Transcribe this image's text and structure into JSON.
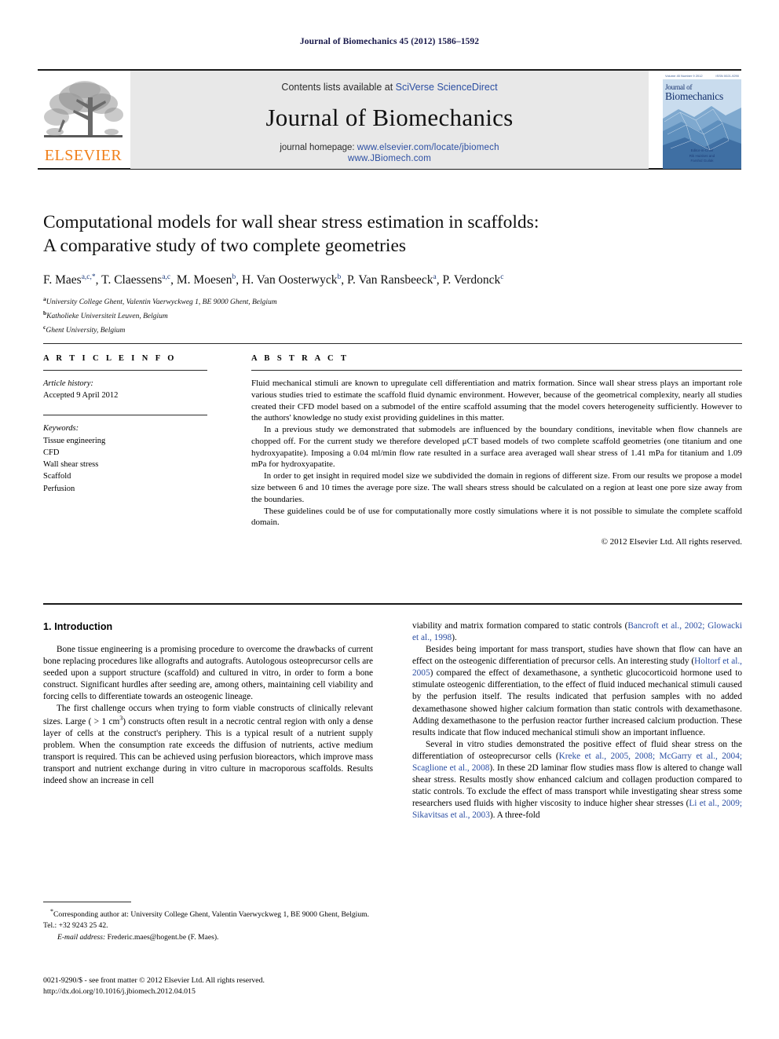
{
  "running_head": "Journal of Biomechanics 45 (2012) 1586–1592",
  "masthead": {
    "contents_prefix": "Contents lists available at ",
    "sciencedirect": "SciVerse ScienceDirect",
    "journal_name": "Journal of Biomechanics",
    "homepage_prefix": "journal homepage: ",
    "homepage_url": "www.elsevier.com/locate/jbiomech",
    "homepage_url2": "www.JBiomech.com",
    "publisher_logo_text": "ELSEVIER",
    "cover": {
      "title_line1": "Journal of",
      "title_line2": "Biomechanics",
      "top_left": "Volume 45 Number 9 2012",
      "top_right": "ISSN 0021-9290",
      "footer_line1": "Editor-in-Chief",
      "footer_line2": "Rik Huiskes and",
      "footer_line3": "Farshid Guilak"
    },
    "accent_link_color": "#2b4ea2",
    "elsevier_orange": "#f07f1a"
  },
  "title": {
    "line1": "Computational models for wall shear stress estimation in scaffolds:",
    "line2": "A comparative study of two complete geometries"
  },
  "authors": [
    {
      "name": "F. Maes",
      "sup": "a,c,*"
    },
    {
      "name": "T. Claessens",
      "sup": "a,c"
    },
    {
      "name": "M. Moesen",
      "sup": "b"
    },
    {
      "name": "H. Van Oosterwyck",
      "sup": "b"
    },
    {
      "name": "P. Van Ransbeeck",
      "sup": "a"
    },
    {
      "name": "P. Verdonck",
      "sup": "c"
    }
  ],
  "affiliations": [
    {
      "mark": "a",
      "text": "University College Ghent, Valentin Vaerwyckweg 1, BE 9000 Ghent, Belgium"
    },
    {
      "mark": "b",
      "text": "Katholieke Universiteit Leuven, Belgium"
    },
    {
      "mark": "c",
      "text": "Ghent University, Belgium"
    }
  ],
  "article_info": {
    "heading": "A R T I C L E   I N F O",
    "history_label": "Article history:",
    "history_value": "Accepted 9 April 2012",
    "keywords_label": "Keywords:",
    "keywords": [
      "Tissue engineering",
      "CFD",
      "Wall shear stress",
      "Scaffold",
      "Perfusion"
    ]
  },
  "abstract": {
    "heading": "A B S T R A C T",
    "paragraphs": [
      "Fluid mechanical stimuli are known to upregulate cell differentiation and matrix formation. Since wall shear stress plays an important role various studies tried to estimate the scaffold fluid dynamic environment. However, because of the geometrical complexity, nearly all studies created their CFD model based on a submodel of the entire scaffold assuming that the model covers heterogeneity sufficiently. However to the authors' knowledge no study exist providing guidelines in this matter.",
      "In a previous study we demonstrated that submodels are influenced by the boundary conditions, inevitable when flow channels are chopped off. For the current study we therefore developed μCT based models of two complete scaffold geometries (one titanium and one hydroxyapatite). Imposing a 0.04 ml/min flow rate resulted in a surface area averaged wall shear stress of 1.41 mPa for titanium and 1.09 mPa for hydroxyapatite.",
      "In order to get insight in required model size we subdivided the domain in regions of different size. From our results we propose a model size between 6 and 10 times the average pore size. The wall shears stress should be calculated on a region at least one pore size away from the boundaries.",
      "These guidelines could be of use for computationally more costly simulations where it is not possible to simulate the complete scaffold domain."
    ],
    "copyright": "© 2012 Elsevier Ltd. All rights reserved."
  },
  "body": {
    "section_heading": "1.  Introduction",
    "left_paragraphs": [
      "Bone tissue engineering is a promising procedure to overcome the drawbacks of current bone replacing procedures like allografts and autografts. Autologous osteoprecursor cells are seeded upon a support structure (scaffold) and cultured in vitro, in order to form a bone construct. Significant hurdles after seeding are, among others, maintaining cell viability and forcing cells to differentiate towards an osteogenic lineage."
    ],
    "left_paragraph_2_parts": {
      "a": "The first challenge occurs when trying to form viable constructs of clinically relevant sizes. Large ( > 1 cm",
      "sup": "3",
      "b": ") constructs often result in a necrotic central region with only a dense layer of cells at the construct's periphery. This is a typical result of a nutrient supply problem. When the consumption rate exceeds the diffusion of nutrients, active medium transport is required. This can be achieved using perfusion bioreactors, which improve mass transport and nutrient exchange during in vitro culture in macroporous scaffolds. Results indeed show an increase in cell"
    },
    "right_paragraph_1": {
      "a": "viability and matrix formation compared to static controls (",
      "cite": "Bancroft et al., 2002; Glowacki et al., 1998",
      "b": ")."
    },
    "right_paragraph_2": {
      "a": "Besides being important for mass transport, studies have shown that flow can have an effect on the osteogenic differentiation of precursor cells. An interesting study (",
      "cite": "Holtorf et al., 2005",
      "b": ") compared the effect of dexamethasone, a synthetic glucocorticoid hormone used to stimulate osteogenic differentiation, to the effect of fluid induced mechanical stimuli caused by the perfusion itself. The results indicated that perfusion samples with no added dexamethasone showed higher calcium formation than static controls with dexamethasone. Adding dexamethasone to the perfusion reactor further increased calcium production. These results indicate that flow induced mechanical stimuli show an important influence."
    },
    "right_paragraph_3": {
      "a": "Several in vitro studies demonstrated the positive effect of fluid shear stress on the differentiation of osteoprecursor cells (",
      "cite1": "Kreke et al., 2005, 2008; McGarry et al., 2004; Scaglione et al., 2008",
      "b": "). In these 2D laminar flow studies mass flow is altered to change wall shear stress. Results mostly show enhanced calcium and collagen production compared to static controls. To exclude the effect of mass transport while investigating shear stress some researchers used fluids with higher viscosity to induce higher shear stresses (",
      "cite2": "Li et al., 2009; Sikavitsas et al., 2003",
      "c": "). A three-fold"
    }
  },
  "footnotes": {
    "corresponding_mark": "*",
    "corresponding_text": "Corresponding author at: University College Ghent, Valentin Vaerwyckweg 1, BE 9000 Ghent, Belgium. Tel.: +32 9243 25 42.",
    "email_label": "E-mail address:",
    "email_value": "Frederic.maes@hogent.be (F. Maes)."
  },
  "imprint": {
    "line1": "0021-9290/$ - see front matter © 2012 Elsevier Ltd. All rights reserved.",
    "line2": "http://dx.doi.org/10.1016/j.jbiomech.2012.04.015"
  }
}
